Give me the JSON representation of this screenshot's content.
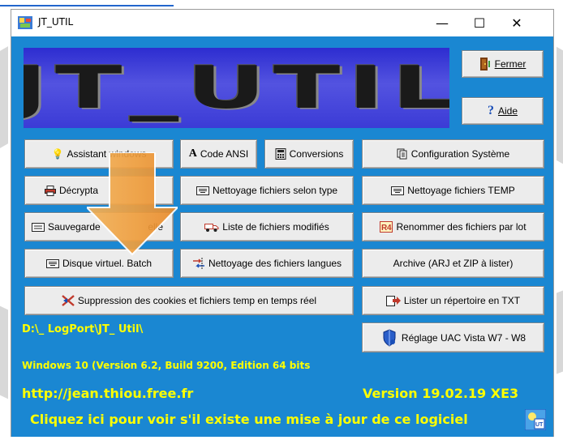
{
  "window": {
    "title": "JT_UTIL",
    "minimize_glyph": "—",
    "maximize_glyph": "☐",
    "close_glyph": "✕"
  },
  "logo": {
    "text": "JT_UTIL"
  },
  "buttons": {
    "fermer": {
      "label": "Fermer",
      "icon": "exit-door-icon"
    },
    "aide": {
      "label": "Aide",
      "icon": "help-icon"
    },
    "assistant": {
      "label": "Assistant windows",
      "icon": "lightbulb-icon"
    },
    "code_ansi": {
      "label": "Code ANSI",
      "icon_text": "A"
    },
    "conversions": {
      "label": "Conversions",
      "icon": "calculator-icon"
    },
    "config": {
      "label": "Configuration Système",
      "icon": "pages-icon"
    },
    "decrypt": {
      "label": "Décrypta",
      "icon": "printer-icon"
    },
    "nett_type": {
      "label": "Nettoyage fichiers selon type",
      "icon": "keyboard-icon"
    },
    "nett_temp": {
      "label": "Nettoyage fichiers TEMP",
      "icon": "keyboard-icon"
    },
    "sauvegarde": {
      "label": "Sauvegarde",
      "label_tail": "elle",
      "icon": "disk-icon"
    },
    "liste_modifies": {
      "label": "Liste de fichiers modifiés",
      "icon": "truck-icon"
    },
    "renommer": {
      "label": "Renommer des fichiers par lot",
      "icon": "rename-icon"
    },
    "disque": {
      "label": "Disque virtuel. Batch",
      "icon": "keyboard-icon"
    },
    "nett_langues": {
      "label": "Nettoyage des fichiers langues",
      "icon": "flag-icon"
    },
    "archive": {
      "label": "Archive (ARJ et ZIP à lister)"
    },
    "cookies": {
      "label": "Suppression des cookies et fichiers temp en temps réel",
      "icon": "cookie-delete-icon"
    },
    "lister_txt": {
      "label": "Lister un répertoire en TXT",
      "icon": "folder-arrow-icon"
    },
    "uac": {
      "label": "Réglage UAC Vista  W7 - W8",
      "icon": "shield-icon"
    }
  },
  "info": {
    "path": "D:\\_ LogPort\\JT_ Util\\",
    "os": "Windows  10 (Version 6.2, Build 9200, Edition 64 bits",
    "url": "http://jean.thiou.free.fr",
    "version": "Version 19.02.19  XE3",
    "update_msg": "Cliquez ici pour voir s'il existe une mise à jour de ce logiciel"
  },
  "colors": {
    "client_bg": "#1a87d2",
    "info_text": "#ffff00",
    "arrow": "#f0a040"
  }
}
